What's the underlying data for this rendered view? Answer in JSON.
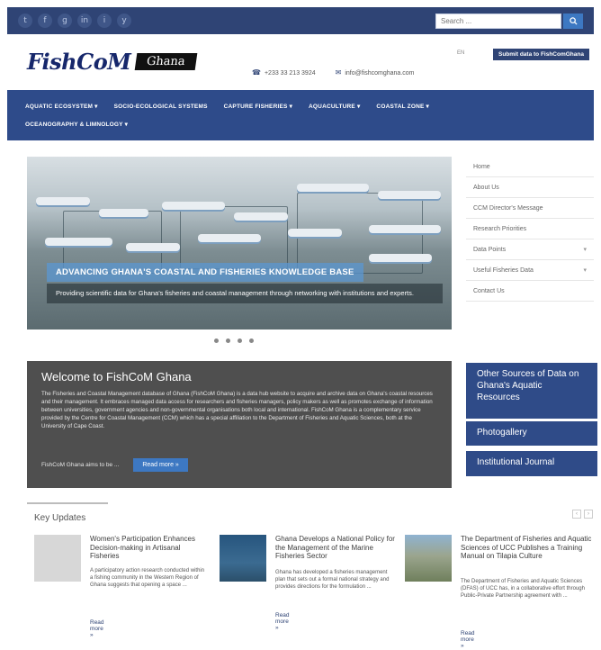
{
  "topbar": {
    "social": [
      "t",
      "f",
      "g",
      "in",
      "i",
      "y"
    ],
    "search_placeholder": "Search ...",
    "search_icon": "search-icon"
  },
  "header": {
    "logo_main": "FishCoM",
    "logo_badge": "Ghana",
    "phone": "+233 33 213 3924",
    "email": "info@fishcomghana.com",
    "lang": "EN",
    "submit_label": "Submit data to FishComGhana"
  },
  "nav": {
    "row1": [
      "AQUATIC ECOSYSTEM ▾",
      "SOCIO-ECOLOGICAL SYSTEMS",
      "CAPTURE FISHERIES ▾",
      "AQUACULTURE ▾",
      "COASTAL ZONE ▾"
    ],
    "row2": [
      "OCEANOGRAPHY & LIMNOLOGY ▾"
    ]
  },
  "slider": {
    "title": "ADVANCING GHANA'S COASTAL AND FISHERIES KNOWLEDGE BASE",
    "caption": "Providing scientific data for Ghana's fisheries and coastal management through networking with institutions and experts."
  },
  "sidemenu": {
    "items": [
      {
        "label": "Home",
        "chev": ""
      },
      {
        "label": "About Us",
        "chev": ""
      },
      {
        "label": "CCM Director's Message",
        "chev": ""
      },
      {
        "label": "Research Priorities",
        "chev": ""
      },
      {
        "label": "Data Points",
        "chev": "▾"
      },
      {
        "label": "Useful Fisheries Data",
        "chev": "▾"
      },
      {
        "label": "Contact Us",
        "chev": ""
      }
    ]
  },
  "welcome": {
    "heading": "Welcome to FishCoM Ghana",
    "body": "The Fisheries and Coastal Management database of Ghana (FishCoM Ghana) is a data hub website to acquire and archive data on Ghana's coastal resources and their management. It embraces managed data access for researchers and fisheries managers, policy makers as well as promotes exchange of information between universities, government agencies and non-governmental organisations both local and international. FishCoM Ghana is a complementary service provided by the Centre for Coastal Management (CCM) which has a special affiliation to the Department of Fisheries and Aquatic Sciences, both at the University of Cape Coast.",
    "footer_text": "FishCoM Ghana aims to be ...",
    "read_more": "Read more »"
  },
  "blueboxes": [
    "Other Sources of Data on Ghana's Aquatic Resources",
    "Photogallery",
    "Institutional Journal"
  ],
  "key_updates": {
    "title": "Key Updates",
    "cards": [
      {
        "title": "Women's Participation Enhances Decision-making in Artisanal Fisheries",
        "desc": "A participatory action research conducted within a fishing community in the Western Region of Ghana suggests that opening a space ...",
        "more": "Read more »"
      },
      {
        "title": "Ghana Develops a National Policy for the Management of the Marine Fisheries Sector",
        "desc": "Ghana has developed a fisheries management plan that sets out a formal national strategy and provides directions for the formulation ...",
        "more": "Read more »"
      },
      {
        "title": "The Department of Fisheries and Aquatic Sciences of UCC Publishes a Training Manual on Tilapia Culture",
        "desc": "The Department of Fisheries and Aquatic Sciences (DFAS) of UCC has, in a collaborative effort through Public-Private Partnership agreement with ...",
        "more": "Read more »"
      }
    ]
  }
}
